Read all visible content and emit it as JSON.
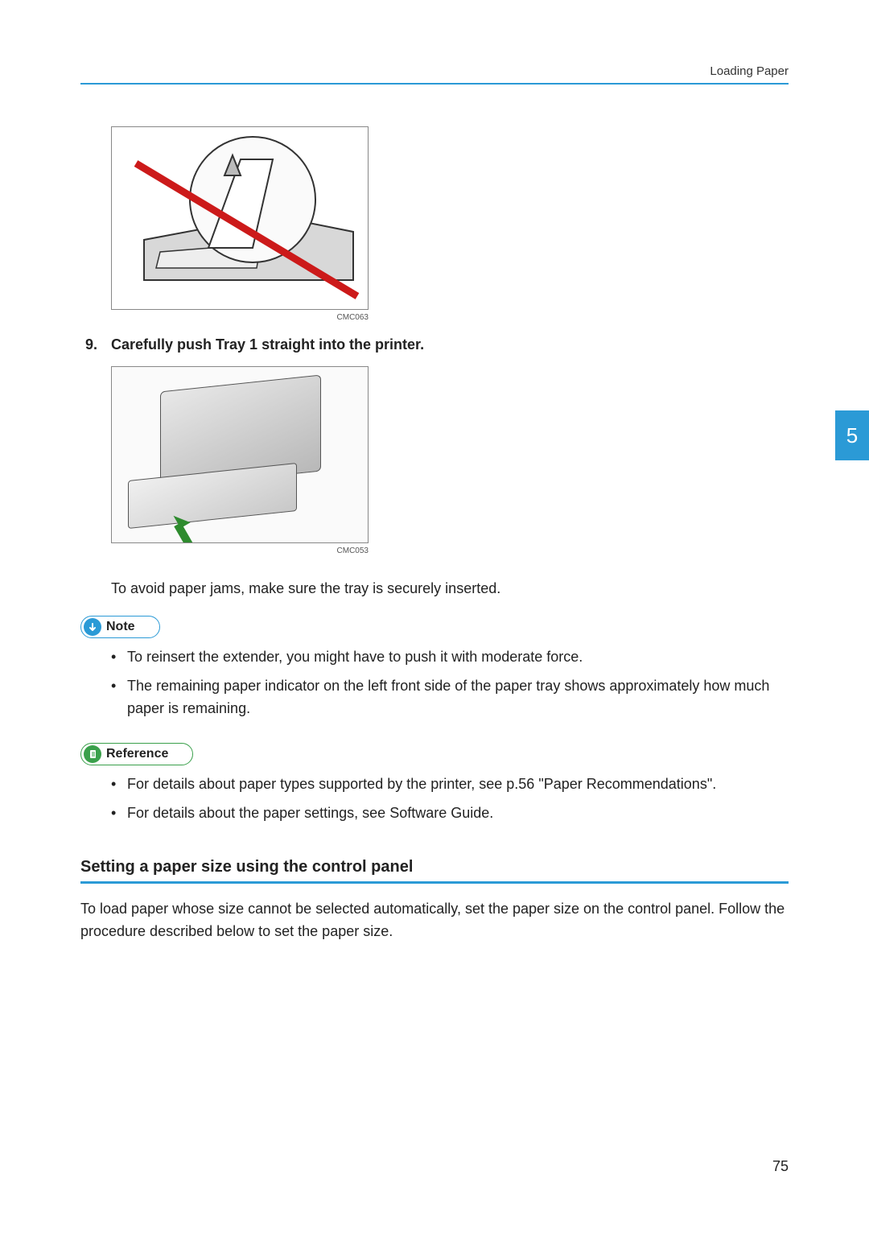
{
  "header": {
    "section": "Loading Paper"
  },
  "chapter": {
    "number": "5"
  },
  "figure1": {
    "caption": "CMC063"
  },
  "step9": {
    "num": "9.",
    "text": "Carefully push Tray 1 straight into the printer."
  },
  "figure2": {
    "caption": "CMC053"
  },
  "after_fig2": "To avoid paper jams, make sure the tray is securely inserted.",
  "note": {
    "label": "Note",
    "items": [
      "To reinsert the extender, you might have to push it with moderate force.",
      "The remaining paper indicator on the left front side of the paper tray shows approximately how much paper is remaining."
    ]
  },
  "reference": {
    "label": "Reference",
    "items": [
      "For details about paper types supported by the printer, see p.56 \"Paper Recommendations\".",
      "For details about the paper settings, see Software Guide."
    ]
  },
  "section": {
    "heading": "Setting a paper size using the control panel",
    "para": "To load paper whose size cannot be selected automatically, set the paper size on the control panel. Follow the procedure described below to set the paper size."
  },
  "page_number": "75"
}
